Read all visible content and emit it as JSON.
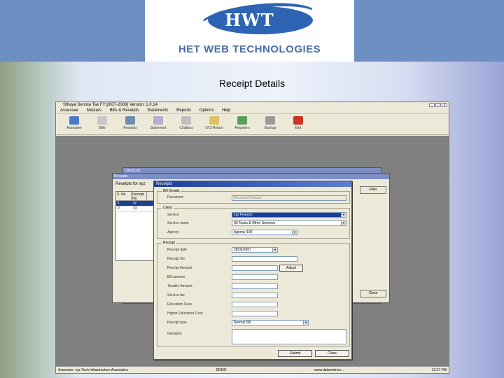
{
  "logo": {
    "emblem_text": "HWT",
    "company_name": "HET WEB TECHNOLOGIES"
  },
  "slide": {
    "title": "Receipt Details"
  },
  "app": {
    "title": "Sthaya Service Tax FY(2007-2008) Version: 1.0.14",
    "window_controls": [
      "_",
      "□",
      "x"
    ],
    "menu": [
      "Assessee",
      "Masters",
      "Bills & Receipts",
      "Statements",
      "Reports",
      "Options",
      "Help"
    ],
    "toolbar": [
      {
        "label": "Assessee",
        "icon": "assessee-icon",
        "color": "#4a7bc8"
      },
      {
        "label": "Bills",
        "icon": "bills-icon",
        "color": "#c9c9c9"
      },
      {
        "label": "Receipts",
        "icon": "receipts-icon",
        "color": "#6f8fb0"
      },
      {
        "label": "Statement",
        "icon": "statement-icon",
        "color": "#b0b0d0"
      },
      {
        "label": "Challans",
        "icon": "challans-icon",
        "color": "#bfbfbf"
      },
      {
        "label": "ST3 Return",
        "icon": "return-icon",
        "color": "#e0c060"
      },
      {
        "label": "Registers",
        "icon": "registers-icon",
        "color": "#5aa05a"
      },
      {
        "label": "Backup",
        "icon": "backup-icon",
        "color": "#9a9a9a"
      },
      {
        "label": "Exit",
        "icon": "exit-icon",
        "color": "#d03020"
      }
    ],
    "status": {
      "left": "Assessee: xyz Tech Infrastructure Associates",
      "middle": "DEMO",
      "right_a": "www.datametrics...",
      "right_b": "12:37 PM"
    }
  },
  "client_list": {
    "title": "Client List"
  },
  "receipts_bg": {
    "title": "Receipts",
    "caption": "Receipts for xyz",
    "columns": [
      "S. No",
      "Receipt No"
    ],
    "rows": [
      [
        "1",
        "xy"
      ],
      [
        "2",
        "23"
      ]
    ],
    "filter_label": "Filter",
    "close_label": "Close"
  },
  "dialog": {
    "title": "Receipts",
    "section_bill": "Bill Details",
    "section_client": "Client",
    "section_receipt": "Receipt",
    "labels": {
      "document": "Document",
      "service": "Service",
      "service_name": "Service name",
      "agency": "Agency",
      "receipt_date": "Receipt date",
      "receipt_no": "Receipt No",
      "receipt_amount": "Receipt Amount",
      "bill_amount": "Bill amount",
      "taxable_amount": "Taxable Amount",
      "service_tax": "Service tax",
      "education_cess": "Education Cess",
      "higher_education_cess": "Higher Education Cess",
      "receipt_type": "Receipt type",
      "narration": "Narration"
    },
    "values": {
      "document": "Received Cheque",
      "service": "xyz Finance",
      "service_name": "All Taxes & Other Services",
      "agency": "Agency 100",
      "receipt_date": "28/02/2007",
      "receipt_type": "Normal SB"
    },
    "adjust_label": "Adjust",
    "submit_label": "Submit",
    "close_label": "Close"
  }
}
